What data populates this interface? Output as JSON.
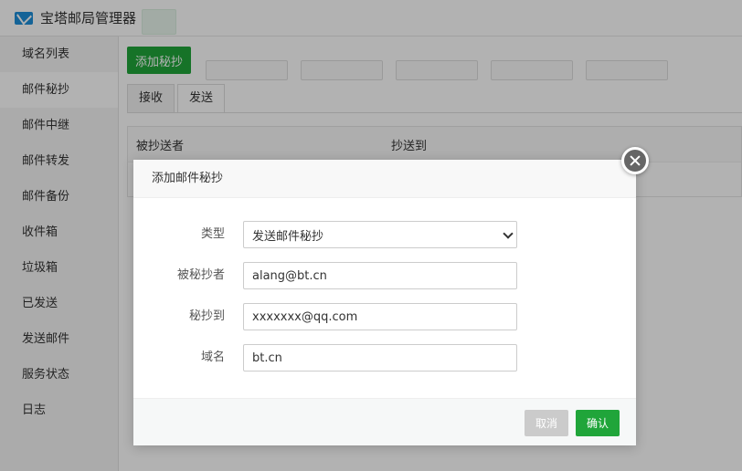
{
  "app": {
    "title": "宝塔邮局管理器"
  },
  "sidebar": {
    "items": [
      {
        "label": "域名列表"
      },
      {
        "label": "邮件秘抄"
      },
      {
        "label": "邮件中继"
      },
      {
        "label": "邮件转发"
      },
      {
        "label": "邮件备份"
      },
      {
        "label": "收件箱"
      },
      {
        "label": "垃圾箱"
      },
      {
        "label": "已发送"
      },
      {
        "label": "发送邮件"
      },
      {
        "label": "服务状态"
      },
      {
        "label": "日志"
      }
    ],
    "active_index": 1
  },
  "toolbar": {
    "add_label": "添加秘抄"
  },
  "tabs": [
    {
      "label": "接收"
    },
    {
      "label": "发送"
    }
  ],
  "table": {
    "columns": [
      "被抄送者",
      "抄送到"
    ]
  },
  "modal": {
    "title": "添加邮件秘抄",
    "fields": {
      "type": {
        "label": "类型",
        "value": "发送邮件秘抄"
      },
      "sender": {
        "label": "被秘抄者",
        "value": "alang@bt.cn"
      },
      "target": {
        "label": "秘抄到",
        "value": "xxxxxxx@qq.com"
      },
      "domain": {
        "label": "域名",
        "value": "bt.cn"
      }
    },
    "cancel_label": "取消",
    "ok_label": "确认"
  },
  "colors": {
    "primary": "#20a53a",
    "cancel": "#cbcbcb",
    "logo": "#1e8fd8"
  }
}
